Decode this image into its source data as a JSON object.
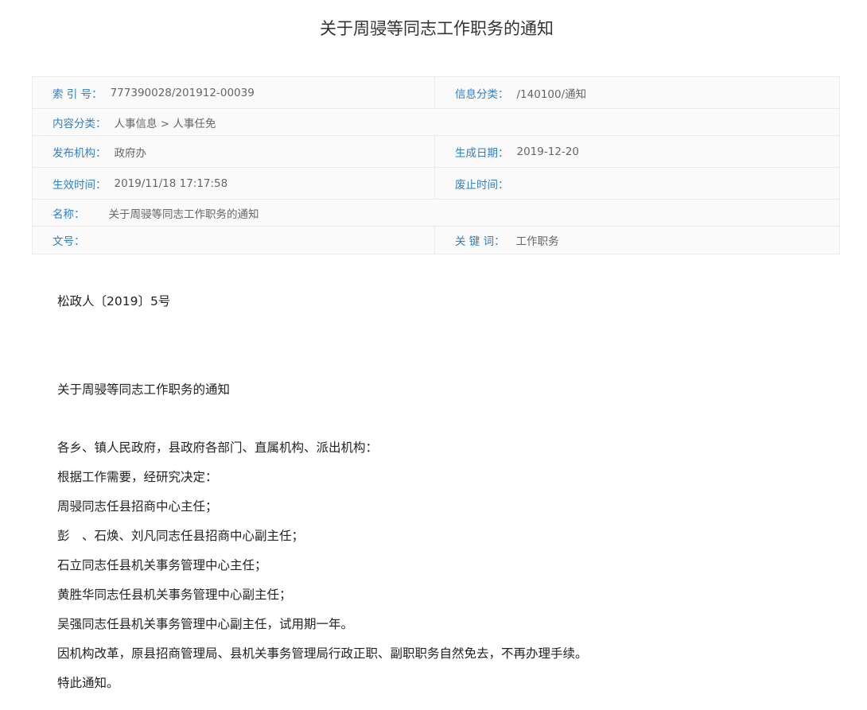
{
  "title": "关于周骎等同志工作职务的通知",
  "meta": {
    "index_label": "索 引 号：",
    "index_value": "777390028/201912-00039",
    "category_label": "信息分类：",
    "category_value": "/140100/通知",
    "content_type_label": "内容分类：",
    "content_type_value": "人事信息 > 人事任免",
    "issuer_label": "发布机构：",
    "issuer_value": "政府办",
    "created_label": "生成日期：",
    "created_value": "2019-12-20",
    "effective_label": "生效时间：",
    "effective_value": "2019/11/18 17:17:58",
    "expiry_label": "废止时间：",
    "expiry_value": "",
    "name_label": "名称：",
    "name_value": "关于周骎等同志工作职务的通知",
    "doc_no_label": "文号：",
    "doc_no_value": "",
    "keywords_label": "关 键 词：",
    "keywords_value": "工作职务"
  },
  "body": {
    "doc_number": "松政人〔2019〕5号",
    "heading": "关于周骎等同志工作职务的通知",
    "lines": [
      "各乡、镇人民政府，县政府各部门、直属机构、派出机构：",
      "根据工作需要，经研究决定：",
      "周骎同志任县招商中心主任；",
      "彭　、石焕、刘凡同志任县招商中心副主任；",
      "石立同志任县机关事务管理中心主任；",
      "黄胜华同志任县机关事务管理中心副主任；",
      "吴强同志任县机关事务管理中心副主任，试用期一年。",
      "因机构改革，原县招商管理局、县机关事务管理局行政正职、副职职务自然免去，不再办理手续。",
      "特此通知。"
    ]
  }
}
